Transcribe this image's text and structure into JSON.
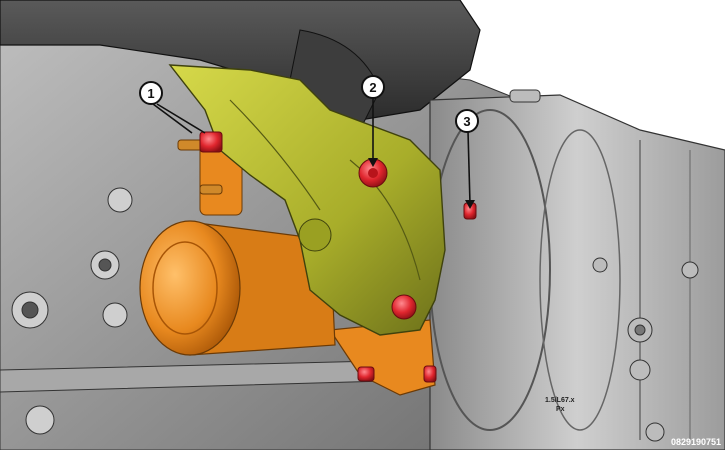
{
  "figure_id": "0829190751",
  "callouts": [
    {
      "label": "1"
    },
    {
      "label": "2"
    },
    {
      "label": "3"
    }
  ],
  "case_markings": {
    "stamp_line1": "1.5/L67.x",
    "stamp_line2": "Px"
  },
  "colors": {
    "bracket": "#a8ad2a",
    "starter": "#e8891f",
    "fastener": "#e0262e",
    "engine_gray": "#9a9a9a",
    "background": "#ffffff"
  }
}
